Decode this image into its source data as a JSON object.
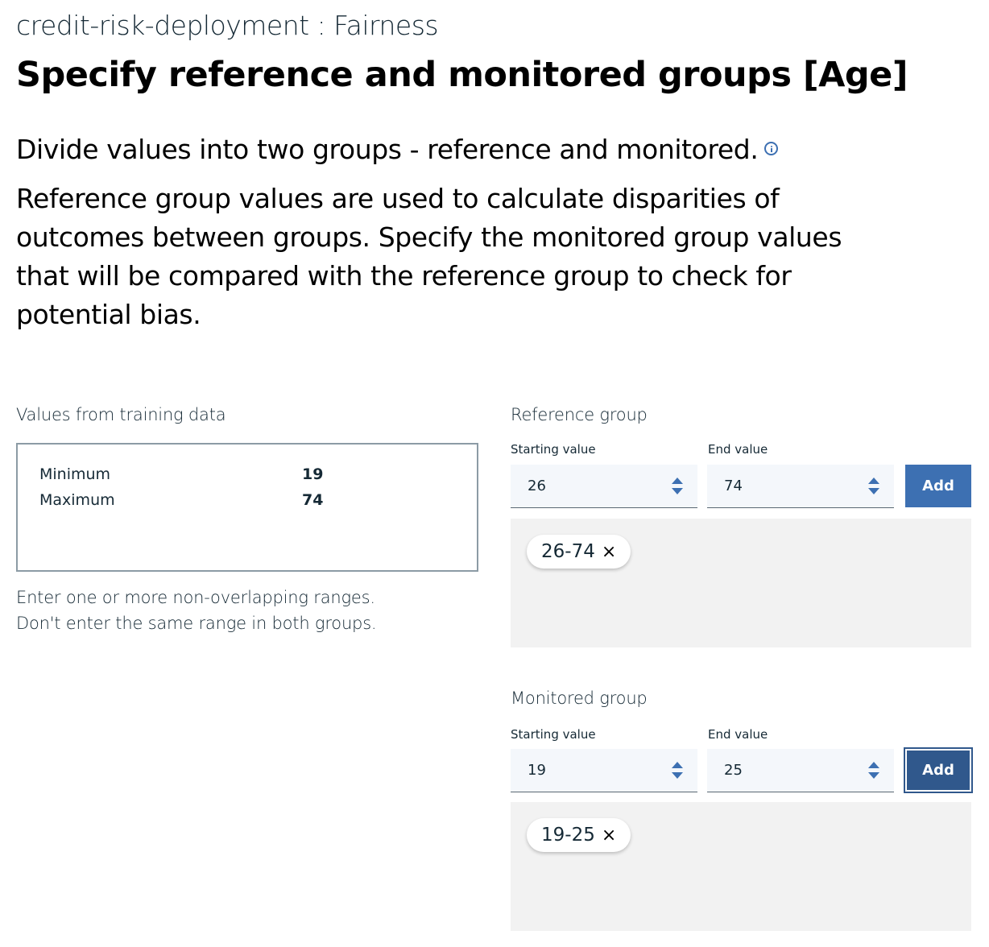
{
  "header": {
    "breadcrumb": "credit-risk-deployment : Fairness",
    "title": "Specify reference and monitored groups [Age]"
  },
  "intro": {
    "lead": "Divide values into two groups - reference and monitored.",
    "description": "Reference group values are used to calculate disparities of outcomes between groups. Specify the monitored group values that will be compared with the reference group to check for potential bias.",
    "info_icon": "info-icon"
  },
  "training": {
    "label": "Values from training data",
    "min_label": "Minimum",
    "min_value": "19",
    "max_label": "Maximum",
    "max_value": "74",
    "hint_line1": "Enter one or more non-overlapping ranges.",
    "hint_line2": "Don't enter the same range in both groups."
  },
  "reference_group": {
    "label": "Reference group",
    "start_label": "Starting value",
    "start_value": "26",
    "end_label": "End value",
    "end_value": "74",
    "add_label": "Add",
    "tags": [
      {
        "text": "26-74",
        "close": "×"
      }
    ]
  },
  "monitored_group": {
    "label": "Monitored group",
    "start_label": "Starting value",
    "start_value": "19",
    "end_label": "End value",
    "end_value": "25",
    "add_label": "Add",
    "tags": [
      {
        "text": "19-25",
        "close": "×"
      }
    ]
  },
  "colors": {
    "accent": "#3d70b2",
    "accent_dark": "#30588c",
    "text": "#152935",
    "input_bg": "#f4f7fb",
    "tag_area_bg": "#f2f2f2"
  }
}
